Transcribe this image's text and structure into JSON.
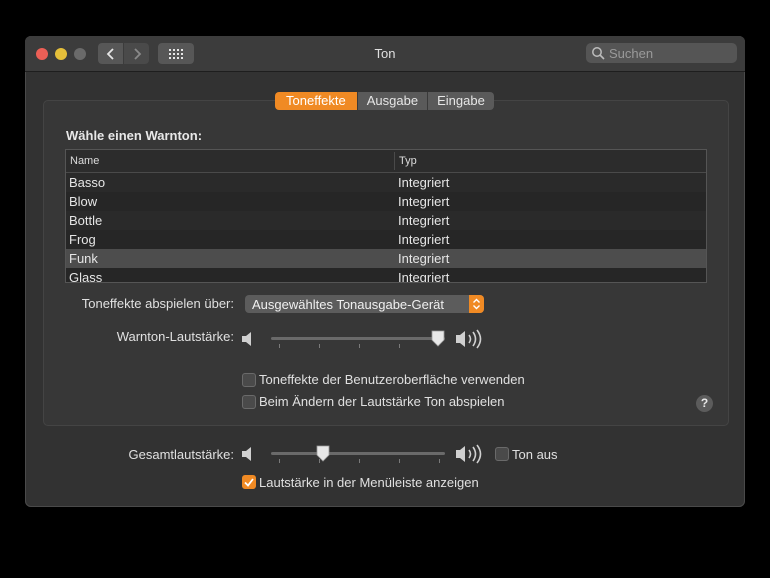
{
  "window": {
    "title": "Ton"
  },
  "search": {
    "placeholder": "Suchen"
  },
  "tabs": [
    {
      "label": "Toneffekte",
      "active": true
    },
    {
      "label": "Ausgabe",
      "active": false
    },
    {
      "label": "Eingabe",
      "active": false
    }
  ],
  "alert": {
    "heading": "Wähle einen Warnton:",
    "columns": {
      "name": "Name",
      "type": "Typ"
    },
    "rows": [
      {
        "name": "Basso",
        "type": "Integriert"
      },
      {
        "name": "Blow",
        "type": "Integriert"
      },
      {
        "name": "Bottle",
        "type": "Integriert"
      },
      {
        "name": "Frog",
        "type": "Integriert"
      },
      {
        "name": "Funk",
        "type": "Integriert",
        "selected": true
      },
      {
        "name": "Glass",
        "type": "Integriert"
      }
    ]
  },
  "playback": {
    "label": "Toneffekte abspielen über:",
    "value": "Ausgewähltes Tonausgabe-Gerät"
  },
  "alert_volume": {
    "label": "Warnton-Lautstärke:",
    "level": 1.0
  },
  "options": {
    "ui_sounds": {
      "label": "Toneffekte der Benutzeroberfläche verwenden",
      "checked": false
    },
    "feedback": {
      "label": "Beim Ändern der Lautstärke Ton abspielen",
      "checked": false
    }
  },
  "help": {
    "label": "?"
  },
  "output_volume": {
    "label": "Gesamtlautstärke:",
    "level": 0.28
  },
  "mute": {
    "label": "Ton aus",
    "checked": false
  },
  "menubar": {
    "label": "Lautstärke in der Menüleiste anzeigen",
    "checked": true
  },
  "colors": {
    "accent": "#f08a24",
    "window": "#323232",
    "panel": "#373737"
  }
}
